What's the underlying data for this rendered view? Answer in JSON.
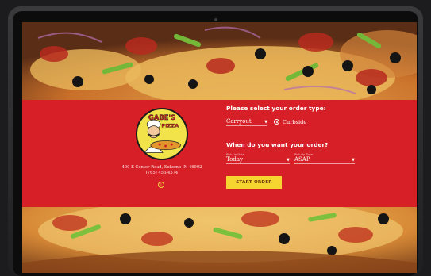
{
  "brand": {
    "logo_text_1": "GABE'S",
    "logo_text_2": "PIZZA"
  },
  "location": {
    "address": "400 E Center Road, Kokomo IN 46902",
    "phone": "(765) 453-4574"
  },
  "order_type": {
    "heading": "Please select your order type:",
    "selected": "Carryout",
    "alt_option": "Curbside"
  },
  "order_time": {
    "heading": "When do you want your order?",
    "date_label": "Pick Up Date",
    "date_value": "Today",
    "time_label": "Pick Up Time",
    "time_value": "ASAP"
  },
  "start_button": "START ORDER",
  "colors": {
    "accent_red": "#d61f26",
    "button_yellow": "#f6d531"
  },
  "icons": {
    "info": "info-icon",
    "caret": "chevron-down-icon"
  }
}
